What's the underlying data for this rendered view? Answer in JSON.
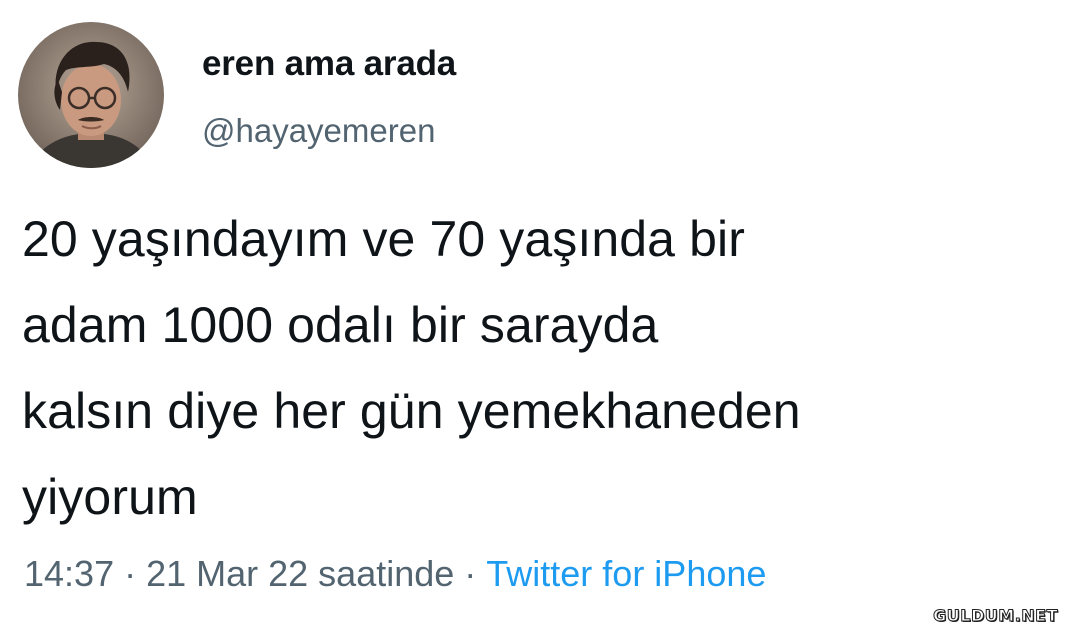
{
  "user": {
    "display_name": "eren ama arada",
    "handle": "@hayayemeren",
    "avatar_icon": "profile-photo-avatar"
  },
  "tweet": {
    "lines": [
      "20 yaşındayım ve 70 yaşında bir",
      "adam 1000 odalı bir sarayda",
      "kalsın diye her gün yemekhaneden",
      "yiyorum"
    ]
  },
  "meta": {
    "timestamp": "14:37 · 21 Mar 22 saatinde",
    "separator": "·",
    "source": "Twitter for iPhone"
  },
  "watermark": {
    "text": "GULDUM.NET"
  },
  "colors": {
    "text": "#0f1419",
    "secondary": "#536471",
    "link": "#1d9bf0",
    "background": "#ffffff"
  }
}
